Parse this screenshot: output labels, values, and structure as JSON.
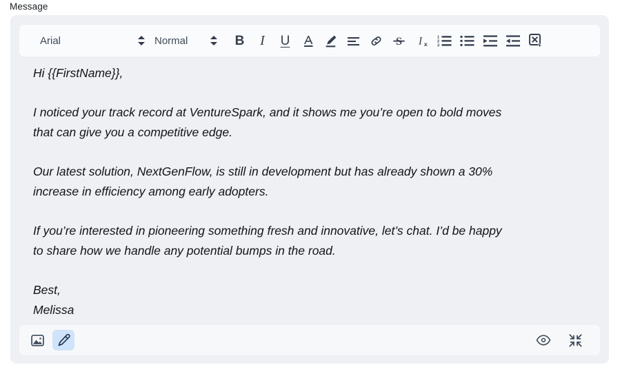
{
  "field": {
    "label": "Message"
  },
  "toolbar": {
    "font_family": {
      "value": "Arial",
      "name": "font-family-select"
    },
    "font_size": {
      "value": "Normal",
      "name": "font-size-select"
    },
    "buttons": [
      {
        "name": "bold-icon",
        "label": "B",
        "title": "Bold"
      },
      {
        "name": "italic-icon",
        "label": "I",
        "title": "Italic"
      },
      {
        "name": "underline-icon",
        "label": "U",
        "title": "Underline"
      },
      {
        "name": "text-color-icon",
        "label": "A",
        "title": "Text color"
      },
      {
        "name": "highlighter-icon",
        "label": "",
        "title": "Highlight"
      },
      {
        "name": "align-icon",
        "label": "",
        "title": "Align"
      },
      {
        "name": "link-icon",
        "label": "",
        "title": "Insert link"
      },
      {
        "name": "strikethrough-icon",
        "label": "S",
        "title": "Strikethrough"
      },
      {
        "name": "clear-formatting-icon",
        "label": "I",
        "title": "Clear formatting"
      },
      {
        "name": "ordered-list-icon",
        "label": "",
        "title": "Numbered list"
      },
      {
        "name": "bullet-list-icon",
        "label": "",
        "title": "Bulleted list"
      },
      {
        "name": "indent-icon",
        "label": "",
        "title": "Increase indent"
      },
      {
        "name": "outdent-icon",
        "label": "",
        "title": "Decrease indent"
      },
      {
        "name": "remove-image-icon",
        "label": "",
        "title": "Remove image"
      }
    ],
    "list_markers": [
      "1",
      "2",
      "3"
    ]
  },
  "message": {
    "paragraphs": [
      {
        "id": "greeting",
        "lines": [
          "Hi {{FirstName}},"
        ]
      },
      {
        "id": "intro",
        "lines": [
          "I noticed your track record at VentureSpark, and it shows me you’re open to bold moves",
          "that can give you a competitive edge."
        ]
      },
      {
        "id": "pitch",
        "lines": [
          "Our latest solution, NextGenFlow, is still in development but has already shown a 30%",
          "increase in efficiency among early adopters."
        ]
      },
      {
        "id": "cta",
        "lines": [
          "If you’re interested in pioneering something fresh and innovative, let’s chat. I’d be happy",
          "to share how we handle any potential bumps in the road."
        ]
      },
      {
        "id": "signoff",
        "lines": [
          "Best,",
          "Melissa"
        ]
      }
    ]
  },
  "bottom_bar": {
    "left_buttons": [
      {
        "name": "insert-image-icon",
        "title": "Insert image",
        "active": false
      },
      {
        "name": "edit-pencil-icon",
        "title": "Edit",
        "active": true
      }
    ],
    "right_buttons": [
      {
        "name": "preview-eye-icon",
        "title": "Preview"
      },
      {
        "name": "collapse-icon",
        "title": "Collapse"
      }
    ]
  },
  "colors": {
    "card_background": "#eef0f3",
    "toolbar_background": "#fafbfc",
    "icon": "#3d4a5c",
    "active_button_background": "#cfe3fb",
    "text": "#111418"
  }
}
